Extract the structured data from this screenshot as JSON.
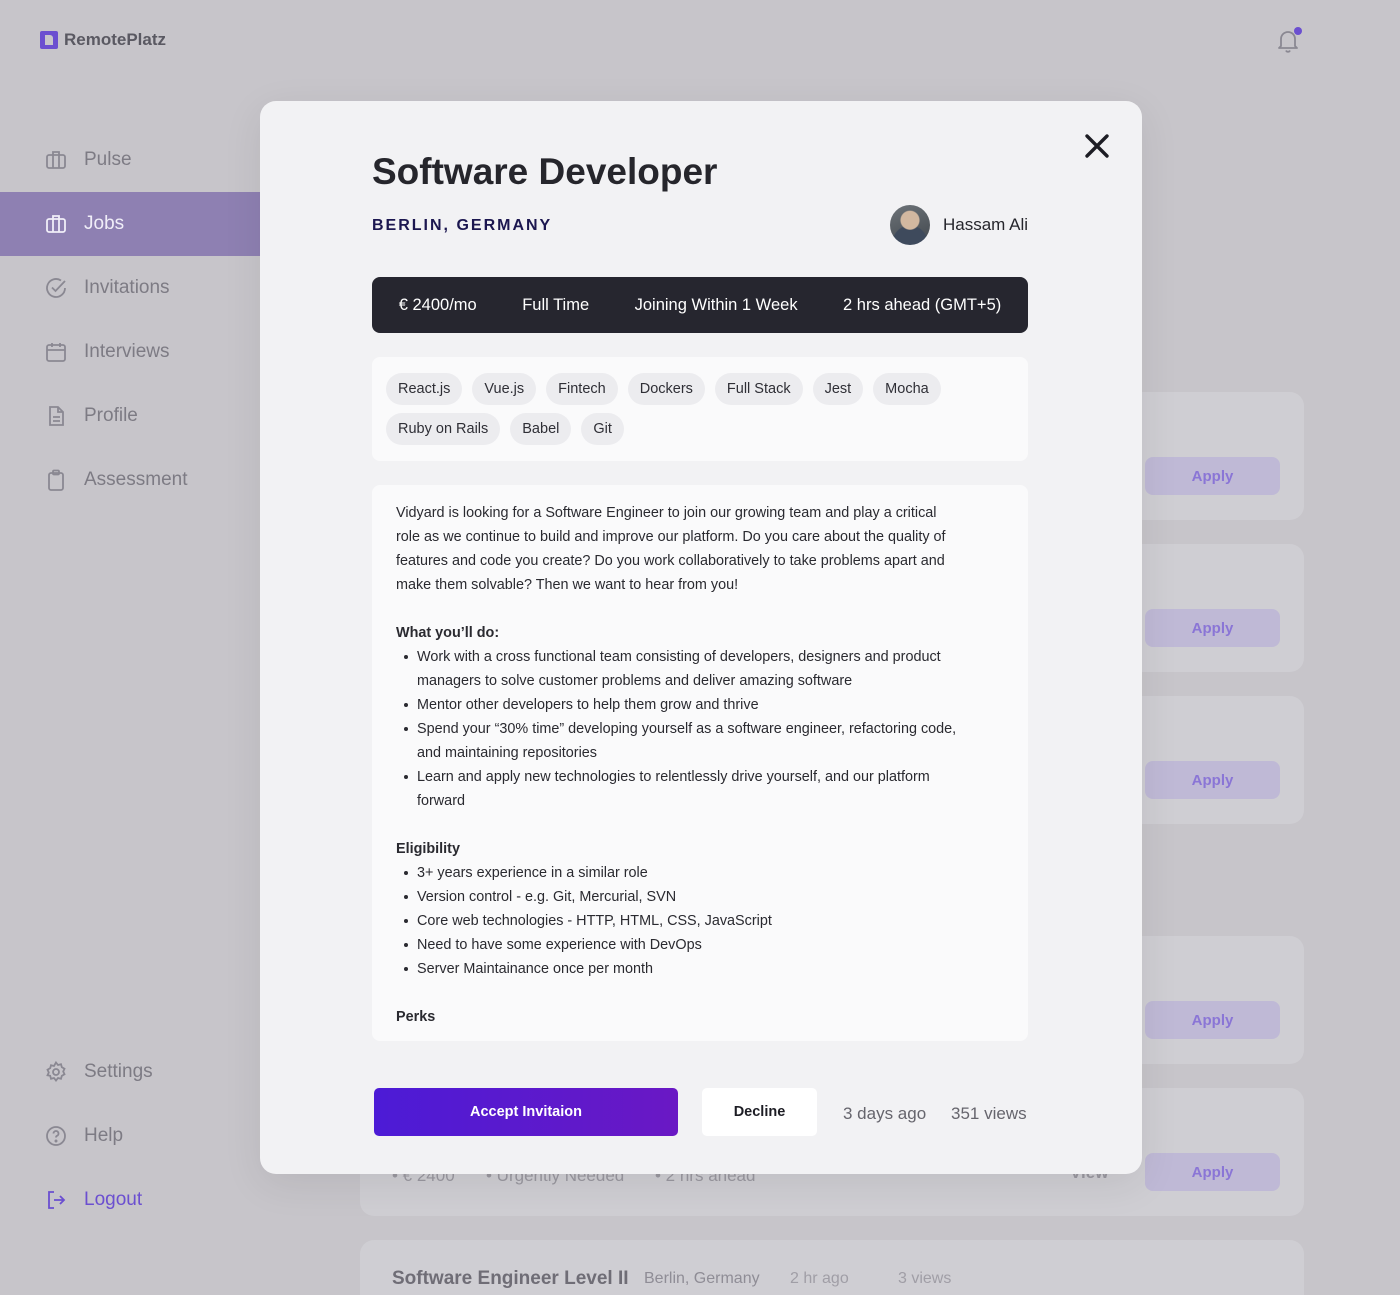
{
  "app": {
    "name": "RemotePlatz"
  },
  "sidebar": {
    "items": [
      {
        "label": "Pulse",
        "icon": "briefcase-icon",
        "active": false
      },
      {
        "label": "Jobs",
        "icon": "briefcase-icon",
        "active": true
      },
      {
        "label": "Invitations",
        "icon": "check-circle-icon",
        "active": false
      },
      {
        "label": "Interviews",
        "icon": "calendar-icon",
        "active": false
      },
      {
        "label": "Profile",
        "icon": "document-icon",
        "active": false
      },
      {
        "label": "Assessment",
        "icon": "clipboard-icon",
        "active": false
      }
    ],
    "bottom": [
      {
        "label": "Settings",
        "icon": "gear-icon"
      },
      {
        "label": "Help",
        "icon": "help-circle-icon"
      },
      {
        "label": "Logout",
        "icon": "logout-icon"
      }
    ]
  },
  "background": {
    "apply_label": "Apply",
    "view_label": "View",
    "partial_meta": [
      "• € 2400",
      "• Urgently Needed",
      "• 2 hrs ahead"
    ],
    "last_card": {
      "title": "Software Engineer Level II",
      "location": "Berlin, Germany",
      "posted": "2 hr ago",
      "views": "3 views"
    }
  },
  "modal": {
    "title": "Software Developer",
    "location": "BERLIN, GERMANY",
    "poster": "Hassam Ali",
    "info": [
      "€ 2400/mo",
      "Full Time",
      "Joining Within 1 Week",
      "2 hrs ahead (GMT+5)"
    ],
    "tags": [
      "React.js",
      "Vue.js",
      "Fintech",
      "Dockers",
      "Full Stack",
      "Jest",
      "Mocha",
      "Ruby on Rails",
      "Babel",
      "Git"
    ],
    "description": {
      "intro": "Vidyard is looking for a Software Engineer to join our growing team and play a critical role as we continue to build and improve our platform. Do you care about the quality of features and code you create? Do you work collaboratively to take problems apart and make them solvable? Then we want to hear from you!",
      "what_heading": "What you’ll do:",
      "what_items": [
        "Work with a cross functional team consisting of developers, designers and product managers to solve customer problems and deliver amazing software",
        "Mentor other developers to help them grow and thrive",
        "Spend your “30% time” developing yourself as a software engineer, refactoring code, and maintaining repositories",
        "Learn and apply new technologies to relentlessly drive yourself, and our platform forward"
      ],
      "eligibility_heading": "Eligibility",
      "eligibility_items": [
        "3+ years experience in a similar role",
        "Version control - e.g. Git, Mercurial, SVN",
        "Core web technologies - HTTP, HTML, CSS, JavaScript",
        "Need to have some experience with DevOps",
        "Server Maintainance once per month"
      ],
      "perks_heading": "Perks"
    },
    "accept_label": "Accept Invitaion",
    "decline_label": "Decline",
    "posted": "3 days ago",
    "views": "351 views"
  }
}
